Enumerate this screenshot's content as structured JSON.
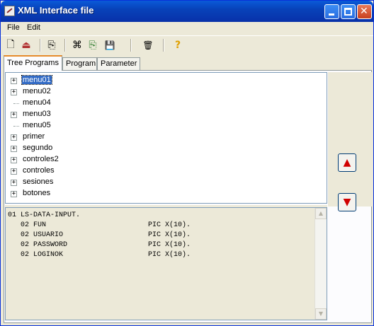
{
  "window": {
    "title": "XML Interface file"
  },
  "menubar": {
    "items": [
      "File",
      "Edit"
    ]
  },
  "toolbar": {
    "icons": [
      "new-file-icon",
      "open-icon",
      "import-icon",
      "tree-icon",
      "export-icon",
      "save-icon",
      "delete-icon",
      "help-icon"
    ],
    "glyphs": {
      "new": "🗋",
      "open": "⏏",
      "import": "⎘",
      "tree": "⌘",
      "export": "⎘",
      "save": "💾",
      "delete": "🗑",
      "help": "?"
    }
  },
  "tabs": [
    {
      "label": "Tree Programs",
      "active": true
    },
    {
      "label": "Program",
      "active": false
    },
    {
      "label": "Parameter",
      "active": false
    }
  ],
  "tree": {
    "nodes": [
      {
        "label": "menu01",
        "expandable": true,
        "selected": true
      },
      {
        "label": "menu02",
        "expandable": true,
        "selected": false
      },
      {
        "label": "menu04",
        "expandable": false,
        "selected": false
      },
      {
        "label": "menu03",
        "expandable": true,
        "selected": false
      },
      {
        "label": "menu05",
        "expandable": false,
        "selected": false
      },
      {
        "label": "primer",
        "expandable": true,
        "selected": false
      },
      {
        "label": "segundo",
        "expandable": true,
        "selected": false
      },
      {
        "label": "controles2",
        "expandable": true,
        "selected": false
      },
      {
        "label": "controles",
        "expandable": true,
        "selected": false
      },
      {
        "label": "sesiones",
        "expandable": true,
        "selected": false
      },
      {
        "label": "botones",
        "expandable": true,
        "selected": false
      }
    ]
  },
  "buttons": {
    "up_glyph": "▲",
    "down_glyph": "▼"
  },
  "code": {
    "lines": [
      "01 LS-DATA-INPUT.",
      "   02 FUN                        PIC X(10).",
      "   02 USUARIO                    PIC X(10).",
      "   02 PASSWORD                   PIC X(10).",
      "   02 LOGINOK                    PIC X(10)."
    ]
  },
  "colors": {
    "selection": "#316ac5",
    "titlebar": "#0842b9",
    "arrow": "#d10000"
  }
}
